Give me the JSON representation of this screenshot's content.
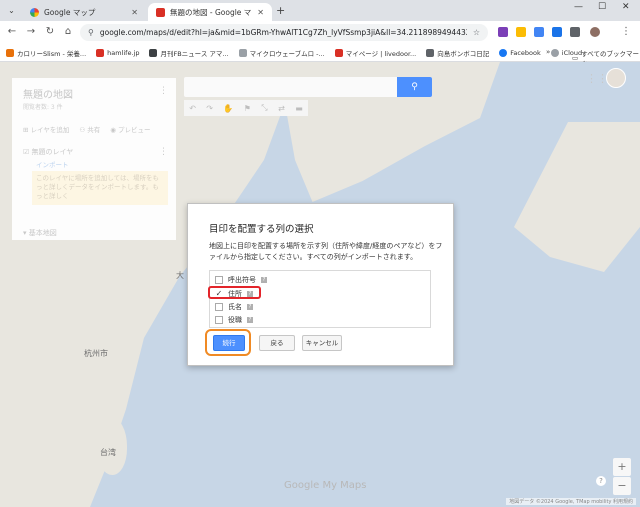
{
  "browser": {
    "tabs": [
      {
        "title": "Google マップ",
        "active": false
      },
      {
        "title": "無題の地図 - Google マイマップ",
        "active": true
      }
    ],
    "new_tab": "+",
    "url": "google.com/maps/d/edit?hl=ja&mid=1bGRm-YhwAlT1Cg7Zh_lyVfSsmp3jiA&ll=34.21189894944327%2...",
    "bookmarks": [
      {
        "label": "カロリーSlism - 栄養...",
        "color": "#e8710a"
      },
      {
        "label": "hamlife.jp",
        "color": "#d93025"
      },
      {
        "label": "月刊FBニュース アマ...",
        "color": "#3c4043"
      },
      {
        "label": "マイクロウェーブムロ -...",
        "color": "#9aa0a6"
      },
      {
        "label": "マイページ | livedoor...",
        "color": "#d93025"
      },
      {
        "label": "向島ボンボコ日記",
        "color": "#5f6368"
      },
      {
        "label": "Facebook",
        "color": "#1877f2"
      },
      {
        "label": "iCloud",
        "color": "#9aa0a6"
      }
    ],
    "bookmarks_more": "»",
    "all_bookmarks": "すべてのブックマーク"
  },
  "panel": {
    "title": "無題の地図",
    "subtitle": "閲覧者数: 3 件",
    "add_layer": "レイヤを追加",
    "share": "共有",
    "preview": "プレビュー",
    "layer_name": "無題のレイヤ",
    "import": "インポート",
    "note": "このレイヤに場所を追加しては、場所をもっと詳しくデータをインポートします。もっと詳しく",
    "base_map": "基本地図"
  },
  "map": {
    "labels": [
      {
        "text": "大",
        "cls": "l-da"
      },
      {
        "text": "杭州市",
        "cls": "l-hz"
      },
      {
        "text": "台湾",
        "cls": "l-tw"
      }
    ],
    "watermark": "Google My Maps",
    "attribution": "地図データ ©2024 Google, TMap mobility   利用規約",
    "zoom_in": "+",
    "zoom_out": "−",
    "help": "?"
  },
  "dialog": {
    "title": "目印を配置する列の選択",
    "description": "地図上に目印を配置する場所を示す列（住所や緯度/経度のペアなど）をファイルから指定してください。すべての列がインポートされます。",
    "columns": [
      {
        "label": "呼出符号",
        "checked": false
      },
      {
        "label": "住所",
        "checked": true
      },
      {
        "label": "氏名",
        "checked": false
      },
      {
        "label": "役職",
        "checked": false
      }
    ],
    "continue": "続行",
    "back": "戻る",
    "cancel": "キャンセル"
  },
  "colors": {
    "accent": "#4d90fe",
    "highlight_red": "#e3252b",
    "highlight_orange": "#f08a24"
  }
}
